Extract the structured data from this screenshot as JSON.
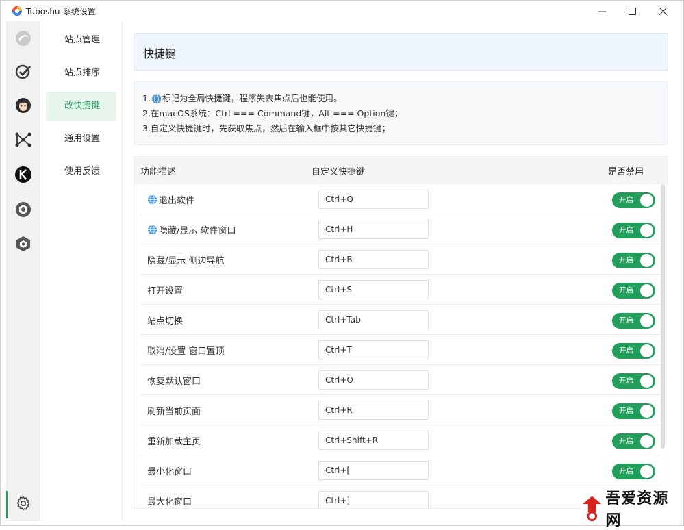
{
  "window": {
    "title": "Tuboshu-系统设置"
  },
  "rail": {
    "icons": [
      "app-swirl-icon",
      "globe-check-icon",
      "avatar-face-icon",
      "network-nodes-icon",
      "k-logo-icon",
      "hexagon-camera-icon",
      "cube-logo-icon"
    ],
    "settings_icon": "gear-icon"
  },
  "menu": {
    "items": [
      {
        "label": "站点管理",
        "active": false
      },
      {
        "label": "站点排序",
        "active": false
      },
      {
        "label": "改快捷键",
        "active": true
      },
      {
        "label": "通用设置",
        "active": false
      },
      {
        "label": "使用反馈",
        "active": false
      }
    ]
  },
  "header": {
    "title": "快捷键"
  },
  "notes": {
    "line1_prefix": "1.",
    "line1_text": "标记为全局快捷键，程序失去焦点后也能使用。",
    "line2": "2.在macOS系统：Ctrl === Command键，Alt === Option键；",
    "line3": "3.自定义快捷键时，先获取焦点，然后在输入框中按其它快捷键；"
  },
  "table": {
    "headers": {
      "desc": "功能描述",
      "shortcut": "自定义快捷键",
      "disabled": "是否禁用"
    },
    "rows": [
      {
        "desc": "退出软件",
        "global": true,
        "shortcut": "Ctrl+Q",
        "toggle": "开启"
      },
      {
        "desc": "隐藏/显示 软件窗口",
        "global": true,
        "shortcut": "Ctrl+H",
        "toggle": "开启"
      },
      {
        "desc": "隐藏/显示 侧边导航",
        "global": false,
        "shortcut": "Ctrl+B",
        "toggle": "开启"
      },
      {
        "desc": "打开设置",
        "global": false,
        "shortcut": "Ctrl+S",
        "toggle": "开启"
      },
      {
        "desc": "站点切换",
        "global": false,
        "shortcut": "Ctrl+Tab",
        "toggle": "开启"
      },
      {
        "desc": "取消/设置 窗口置顶",
        "global": false,
        "shortcut": "Ctrl+T",
        "toggle": "开启"
      },
      {
        "desc": "恢复默认窗口",
        "global": false,
        "shortcut": "Ctrl+O",
        "toggle": "开启"
      },
      {
        "desc": "刷新当前页面",
        "global": false,
        "shortcut": "Ctrl+R",
        "toggle": "开启"
      },
      {
        "desc": "重新加载主页",
        "global": false,
        "shortcut": "Ctrl+Shift+R",
        "toggle": "开启"
      },
      {
        "desc": "最小化窗口",
        "global": false,
        "shortcut": "Ctrl+[",
        "toggle": "开启"
      },
      {
        "desc": "最大化窗口",
        "global": false,
        "shortcut": "Ctrl+]",
        "toggle": "开启"
      }
    ]
  },
  "watermark": {
    "text": "吾爱资源网"
  },
  "colors": {
    "accent": "#2e9a62",
    "toggle_on": "#219f5a",
    "header_bg": "#eef5fd"
  }
}
